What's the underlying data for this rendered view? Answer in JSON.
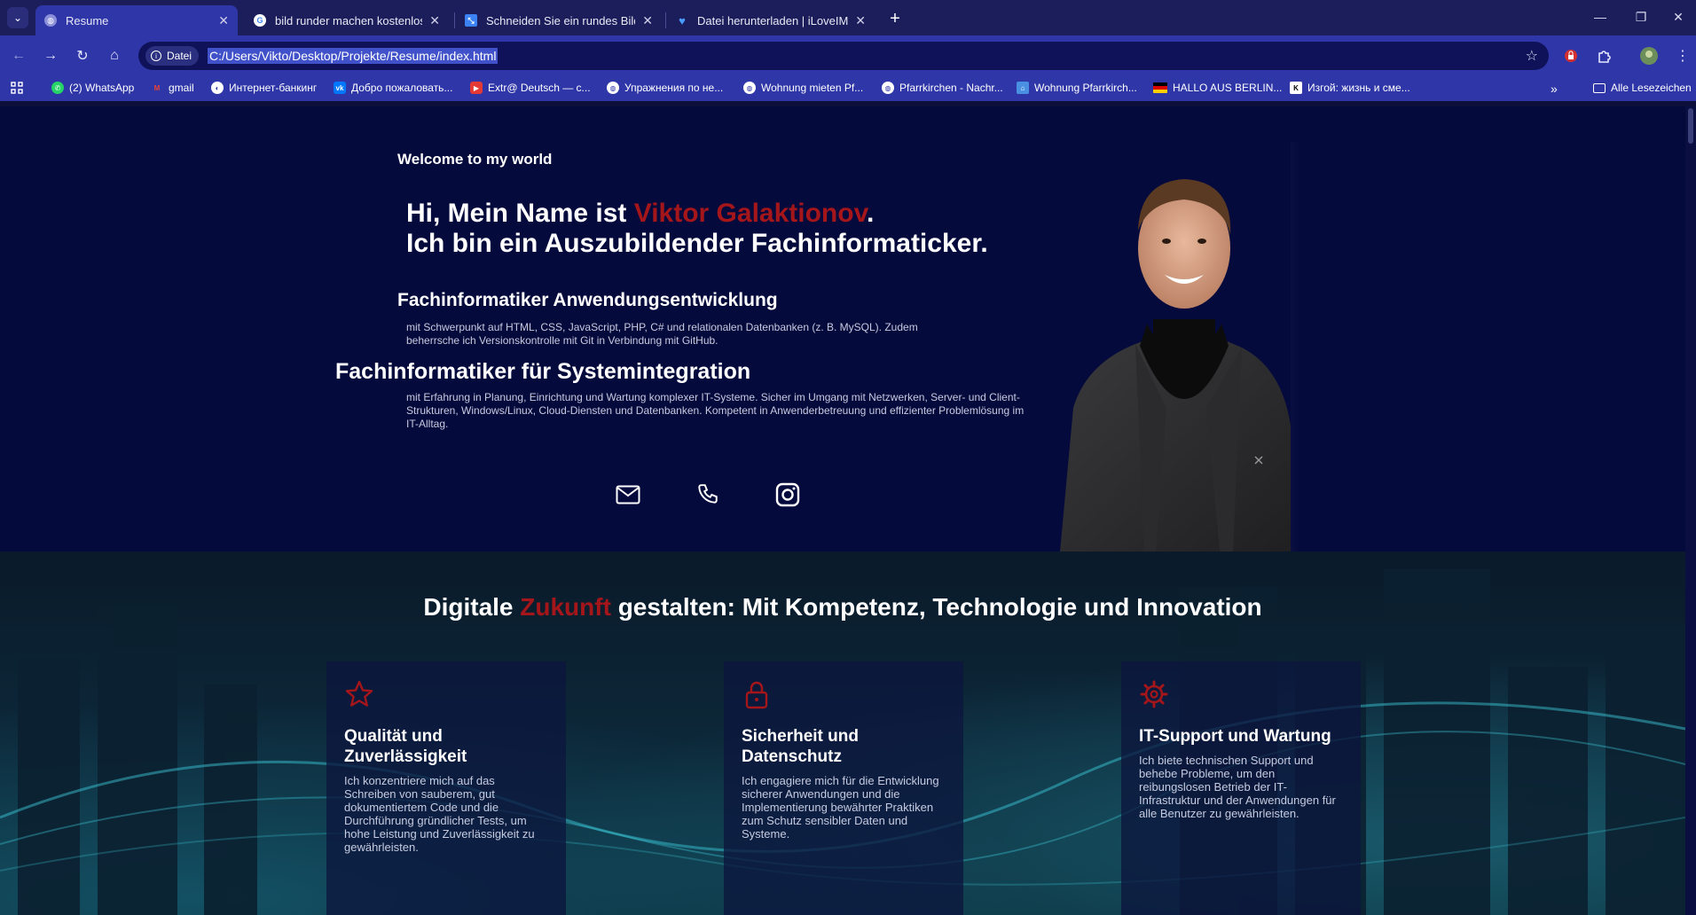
{
  "browser": {
    "tabs": [
      {
        "label": "Resume",
        "active": true,
        "favicon": "globe-icon"
      },
      {
        "label": "bild runder machen kostenlos -",
        "active": false,
        "favicon": "google-icon"
      },
      {
        "label": "Schneiden Sie ein rundes Bild z",
        "active": false,
        "favicon": "crop-icon"
      },
      {
        "label": "Datei herunterladen | iLoveIMG",
        "active": false,
        "favicon": "heart-icon"
      }
    ],
    "address": {
      "chip_label": "Datei",
      "url": "C:/Users/Vikto/Desktop/Projekte/Resume/index.html"
    },
    "bookmarks": [
      {
        "label": "(2) WhatsApp",
        "icon": "whatsapp-icon",
        "color": "#25d366"
      },
      {
        "label": "gmail",
        "icon": "gmail-icon",
        "color": "#ea4335"
      },
      {
        "label": "Интернет-банкинг",
        "icon": "bank-icon",
        "color": "#ffffff"
      },
      {
        "label": "Добро пожаловать...",
        "icon": "vk-icon",
        "color": "#0077ff"
      },
      {
        "label": "Extr@ Deutsch — с...",
        "icon": "video-icon",
        "color": "#e53935"
      },
      {
        "label": "Упражнения по не...",
        "icon": "globe-icon",
        "color": "#ffffff"
      },
      {
        "label": "Wohnung mieten Pf...",
        "icon": "globe-icon",
        "color": "#ffffff"
      },
      {
        "label": "Pfarrkirchen - Nachr...",
        "icon": "globe-icon",
        "color": "#ffffff"
      },
      {
        "label": "Wohnung Pfarrkirch...",
        "icon": "house-icon",
        "color": "#4a90e2"
      },
      {
        "label": "HALLO AUS BERLIN...",
        "icon": "flag-icon",
        "color": "#ffcc00"
      },
      {
        "label": "Изгой: жизнь и сме...",
        "icon": "k-icon",
        "color": "#ffffff"
      }
    ],
    "all_bookmarks_label": "Alle Lesezeichen",
    "overflow_label": "»"
  },
  "hero": {
    "welcome": "Welcome to my world",
    "greeting": "Hi, Mein Name ist ",
    "name": "Viktor Galaktionov",
    "name_suffix": ".",
    "line2": "Ich bin ein Auszubildender Fachinformaticker.",
    "sub1": "Fachinformatiker Anwendungsentwicklung",
    "p1": "mit Schwerpunkt auf HTML, CSS, JavaScript, PHP, C# und relationalen Datenbanken (z. B. MySQL). Zudem beherrsche ich Versionskontrolle mit Git in Verbindung mit GitHub.",
    "sub2": "Fachinformatiker für Systemintegration",
    "p2": "mit Erfahrung in Planung, Einrichtung und Wartung komplexer IT-Systeme. Sicher im Umgang mit Netzwerken, Server- und Client-Strukturen, Windows/Linux, Cloud-Diensten und Datenbanken. Kompetent in Anwenderbetreuung und effizienter Problemlösung im IT-Alltag.",
    "social": [
      "mail-icon",
      "phone-icon",
      "instagram-icon"
    ]
  },
  "services": {
    "title_pre": "Digitale ",
    "title_accent": "Zukunft",
    "title_post": " gestalten: Mit Kompetenz, Technologie und Innovation",
    "accent_color": "#a4161a",
    "cards": [
      {
        "icon": "star-icon",
        "title": "Qualität und Zuverlässigkeit",
        "text": "Ich konzentriere mich auf das Schreiben von sauberem, gut dokumentiertem Code und die Durchführung gründlicher Tests, um hohe Leistung und Zuverlässigkeit zu gewährleisten."
      },
      {
        "icon": "lock-icon",
        "title": "Sicherheit und Datenschutz",
        "text": "Ich engagiere mich für die Entwicklung sicherer Anwendungen und die Implementierung bewährter Praktiken zum Schutz sensibler Daten und Systeme."
      },
      {
        "icon": "gear-icon",
        "title": "IT-Support und Wartung",
        "text": "Ich biete technischen Support und behebe Probleme, um den reibungslosen Betrieb der IT-Infrastruktur und der Anwendungen für alle Benutzer zu gewährleisten."
      }
    ]
  }
}
